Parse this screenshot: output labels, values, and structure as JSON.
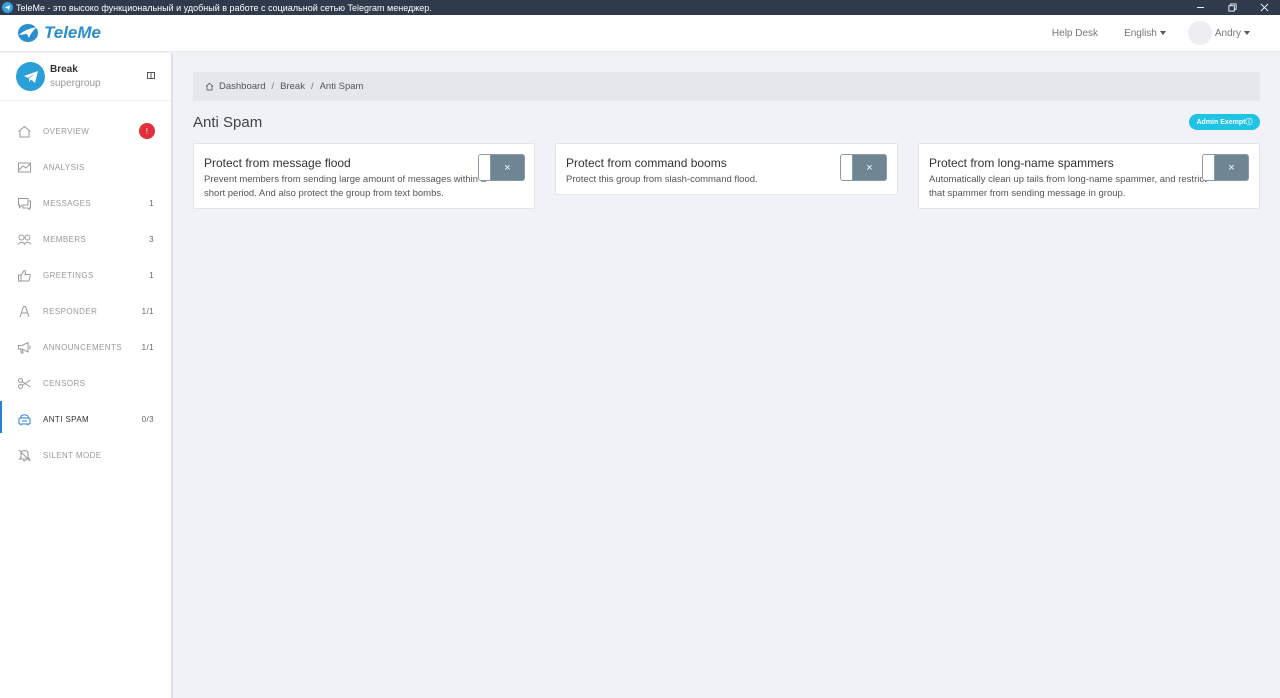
{
  "window": {
    "title": "TeleMe - это высоко функциональный и удобный в работе с социальной сетью Telegram менеджер."
  },
  "navbar": {
    "brand": "TeleMe",
    "help_desk": "Help Desk",
    "language": "English",
    "user": "Andry"
  },
  "group": {
    "name": "Break",
    "type": "supergroup"
  },
  "sidebar": {
    "items": [
      {
        "label": "OVERVIEW",
        "icon": "home-icon",
        "count": "!"
      },
      {
        "label": "ANALYSIS",
        "icon": "chart-icon",
        "count": ""
      },
      {
        "label": "MESSAGES",
        "icon": "messages-icon",
        "count": "1"
      },
      {
        "label": "MEMBERS",
        "icon": "members-icon",
        "count": "3"
      },
      {
        "label": "GREETINGS",
        "icon": "thumbs-up-icon",
        "count": "1"
      },
      {
        "label": "RESPONDER",
        "icon": "responder-icon",
        "count": "1/1"
      },
      {
        "label": "ANNOUNCEMENTS",
        "icon": "megaphone-icon",
        "count": "1/1"
      },
      {
        "label": "CENSORS",
        "icon": "scissors-icon",
        "count": ""
      },
      {
        "label": "ANTI SPAM",
        "icon": "anti-spam-icon",
        "count": "0/3"
      },
      {
        "label": "SILENT MODE",
        "icon": "mute-icon",
        "count": ""
      }
    ]
  },
  "breadcrumb": {
    "items": [
      "Dashboard",
      "Break",
      "Anti Spam"
    ]
  },
  "page": {
    "title": "Anti Spam",
    "admin_exempt": "Admin Exemptⓘ"
  },
  "cards": [
    {
      "title": "Protect from message flood",
      "description": "Prevent members from sending large amount of messages within a short period. And also protect the group from text bombs.",
      "toggle": "×"
    },
    {
      "title": "Protect from command booms",
      "description": "Protect this group from slash-command flood.",
      "toggle": "×"
    },
    {
      "title": "Protect from long-name spammers",
      "description": "Automatically clean up tails from long-name spammer, and restrict that spammer from sending message in group.",
      "toggle": "×"
    }
  ],
  "colors": {
    "accent": "#2a8fcf",
    "toggle_off": "#6f8593",
    "badge_red": "#e0303c",
    "admin_exempt": "#1fc3e6"
  }
}
